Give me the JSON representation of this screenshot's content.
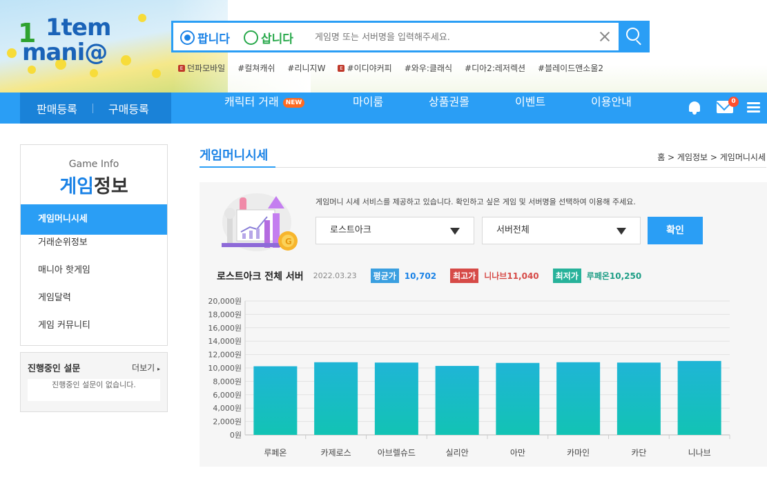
{
  "logo": {
    "text_top": "1tem",
    "text_bottom": "mani@"
  },
  "search": {
    "sell_label": "팝니다",
    "buy_label": "삽니다",
    "placeholder": "게임명 또는 서버명을 입력해주세요."
  },
  "tags": [
    {
      "label": "던파모바일",
      "event": true
    },
    {
      "label": "#컬쳐캐쉬",
      "event": false
    },
    {
      "label": "#리니지W",
      "event": false
    },
    {
      "label": "#이디야커피",
      "event": true
    },
    {
      "label": "#와우:클래식",
      "event": false
    },
    {
      "label": "#디아2:레저렉션",
      "event": false
    },
    {
      "label": "#블레이드앤소울2",
      "event": false
    }
  ],
  "nav": {
    "sell_register": "판매등록",
    "buy_register": "구매등록",
    "items": [
      "캐릭터 거래",
      "마이룸",
      "상품권몰",
      "이벤트",
      "이용안내"
    ],
    "new_badge": "NEW",
    "mail_count": "0"
  },
  "sidebar": {
    "subtitle": "Game Info",
    "title_highlight": "게임",
    "title_rest": "정보",
    "items": [
      "게임머니시세",
      "거래순위정보",
      "매니아 핫게임",
      "게임달력",
      "게임 커뮤니티"
    ]
  },
  "survey": {
    "title": "진행중인 설문",
    "more": "더보기",
    "empty": "진행중인 설문이 없습니다."
  },
  "page": {
    "title": "게임머니시세",
    "breadcrumb": "홈 >  게임정보 >  게임머니시세",
    "description": "게임머니 시세 서비스를 제공하고 있습니다. 확인하고 싶은 게임 및 서버명을 선택하여 이용해 주세요.",
    "game_select": "로스트아크",
    "server_select": "서버전체",
    "confirm": "확인"
  },
  "stats": {
    "server_title": "로스트아크 전체 서버",
    "date": "2022.03.23",
    "avg_label": "평균가",
    "avg_value": "10,702",
    "max_label": "최고가",
    "max_value": "니나브11,040",
    "min_label": "최저가",
    "min_value": "루페온10,250"
  },
  "colors": {
    "accent": "#2a9ef5",
    "bar_top": "#1fb5d6",
    "bar_bottom": "#12c3b4"
  },
  "chart_data": {
    "type": "bar",
    "categories": [
      "루페온",
      "카제로스",
      "아브렐슈드",
      "실리안",
      "아만",
      "카마인",
      "카단",
      "니나브"
    ],
    "values": [
      10250,
      10850,
      10800,
      10300,
      10750,
      10850,
      10800,
      11040
    ],
    "ylim": [
      0,
      20000
    ],
    "yticks": [
      "20,000원",
      "18,000원",
      "16,000원",
      "14,000원",
      "12,000원",
      "10,000원",
      "8,000원",
      "6,000원",
      "4,000원",
      "2,000원",
      "0원"
    ],
    "grid": true
  }
}
